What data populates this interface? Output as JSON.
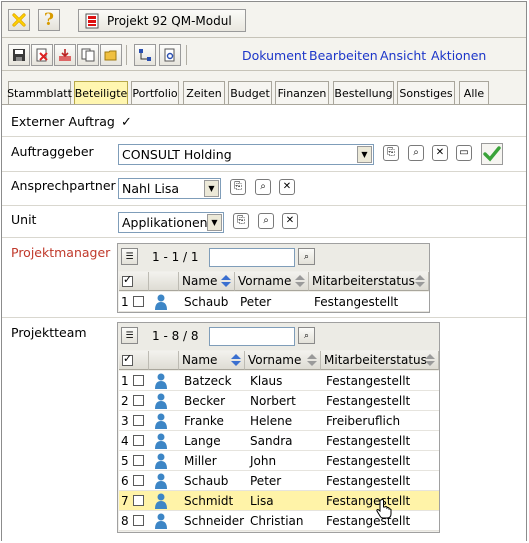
{
  "window": {
    "title": "Projekt 92 QM-Modul"
  },
  "menu": [
    "Dokument",
    "Bearbeiten",
    "Ansicht",
    "Aktionen"
  ],
  "tabs": [
    "Stammblatt",
    "Beteiligte",
    "Portfolio",
    "Zeiten",
    "Budget",
    "Finanzen",
    "Bestellung",
    "Sonstiges",
    "Alle"
  ],
  "active_tab": "Beteiligte",
  "form": {
    "externer_auftrag": {
      "label": "Externer Auftrag",
      "checked": true
    },
    "auftraggeber": {
      "label": "Auftraggeber",
      "value": "CONSULT Holding"
    },
    "ansprechpartner": {
      "label": "Ansprechpartner",
      "value": "Nahl Lisa"
    },
    "unit": {
      "label": "Unit",
      "value": "Applikationen"
    },
    "projektmanager": {
      "label": "Projektmanager",
      "count": "1 - 1 / 1",
      "columns": [
        "Name",
        "Vorname",
        "Mitarbeiterstatus"
      ],
      "rows": [
        {
          "num": "1",
          "name": "Schaub",
          "vorname": "Peter",
          "status": "Festangestellt"
        }
      ]
    },
    "projektteam": {
      "label": "Projektteam",
      "count": "1 - 8 / 8",
      "columns": [
        "Name",
        "Vorname",
        "Mitarbeiterstatus"
      ],
      "rows": [
        {
          "num": "1",
          "name": "Batzeck",
          "vorname": "Klaus",
          "status": "Festangestellt"
        },
        {
          "num": "2",
          "name": "Becker",
          "vorname": "Norbert",
          "status": "Festangestellt"
        },
        {
          "num": "3",
          "name": "Franke",
          "vorname": "Helene",
          "status": "Freiberuflich"
        },
        {
          "num": "4",
          "name": "Lange",
          "vorname": "Sandra",
          "status": "Festangestellt"
        },
        {
          "num": "5",
          "name": "Miller",
          "vorname": "John",
          "status": "Festangestellt"
        },
        {
          "num": "6",
          "name": "Schaub",
          "vorname": "Peter",
          "status": "Festangestellt"
        },
        {
          "num": "7",
          "name": "Schmidt",
          "vorname": "Lisa",
          "status": "Festangestellt"
        },
        {
          "num": "8",
          "name": "Schneider",
          "vorname": "Christian",
          "status": "Festangestellt"
        }
      ],
      "selected_row": 7
    }
  },
  "colors": {
    "menu_link": "#1c36c9",
    "active_tab": "#fff6b0",
    "selected_row": "#fff3a8",
    "label_red": "#c0392b"
  }
}
